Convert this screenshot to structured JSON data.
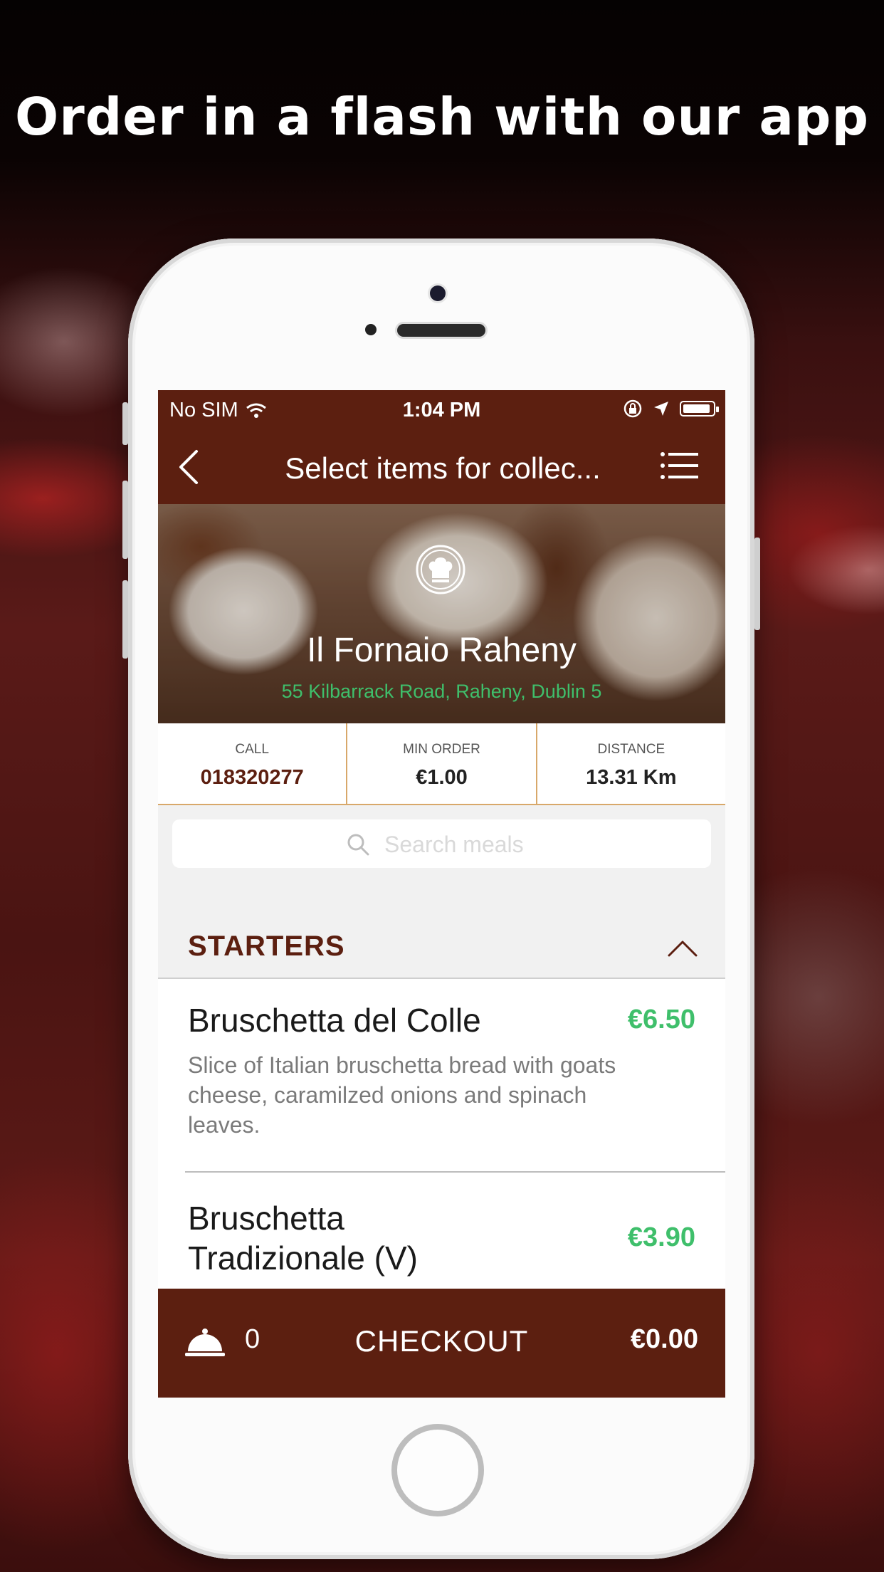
{
  "headline": "Order in a flash with our app",
  "status_bar": {
    "carrier": "No SIM",
    "time": "1:04 PM"
  },
  "nav": {
    "title": "Select items for collec..."
  },
  "restaurant": {
    "name": "Il Fornaio Raheny",
    "address": "55 Kilbarrack Road, Raheny, Dublin 5"
  },
  "info": {
    "call_label": "CALL",
    "call_value": "018320277",
    "min_order_label": "MIN ORDER",
    "min_order_value": "€1.00",
    "distance_label": "DISTANCE",
    "distance_value": "13.31 Km"
  },
  "search": {
    "placeholder": "Search meals",
    "value": ""
  },
  "section": {
    "title": "STARTERS"
  },
  "items": [
    {
      "name": "Bruschetta del Colle",
      "price": "€6.50",
      "description": "Slice of Italian bruschetta bread with goats cheese, caramilzed onions and spinach leaves."
    },
    {
      "name": "Bruschetta Tradizionale (V)",
      "price": "€3.90",
      "description": ""
    }
  ],
  "checkout": {
    "count": "0",
    "label": "CHECKOUT",
    "total": "€0.00"
  },
  "colors": {
    "brand": "#5c1f10",
    "price": "#3fbf6b",
    "divider_accent": "#d8a86a"
  },
  "icons": [
    "wifi-icon",
    "rotation-lock-icon",
    "location-arrow-icon",
    "battery-icon",
    "back-chevron-icon",
    "hamburger-menu-icon",
    "chef-hat-icon",
    "search-icon",
    "chevron-up-icon",
    "cloche-icon"
  ]
}
